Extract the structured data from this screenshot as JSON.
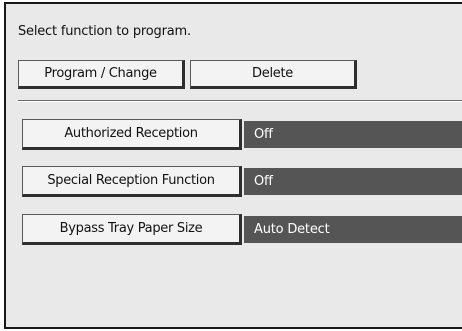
{
  "prompt": "Select function to program.",
  "actions": {
    "program_change": "Program / Change",
    "delete": "Delete"
  },
  "settings": [
    {
      "label": "Authorized Reception",
      "value": "Off"
    },
    {
      "label": "Special Reception Function",
      "value": "Off"
    },
    {
      "label": "Bypass Tray Paper Size",
      "value": "Auto Detect"
    }
  ],
  "colors": {
    "panel_bg": "#e9e9e9",
    "value_bg": "#555555",
    "value_text": "#ffffff"
  }
}
